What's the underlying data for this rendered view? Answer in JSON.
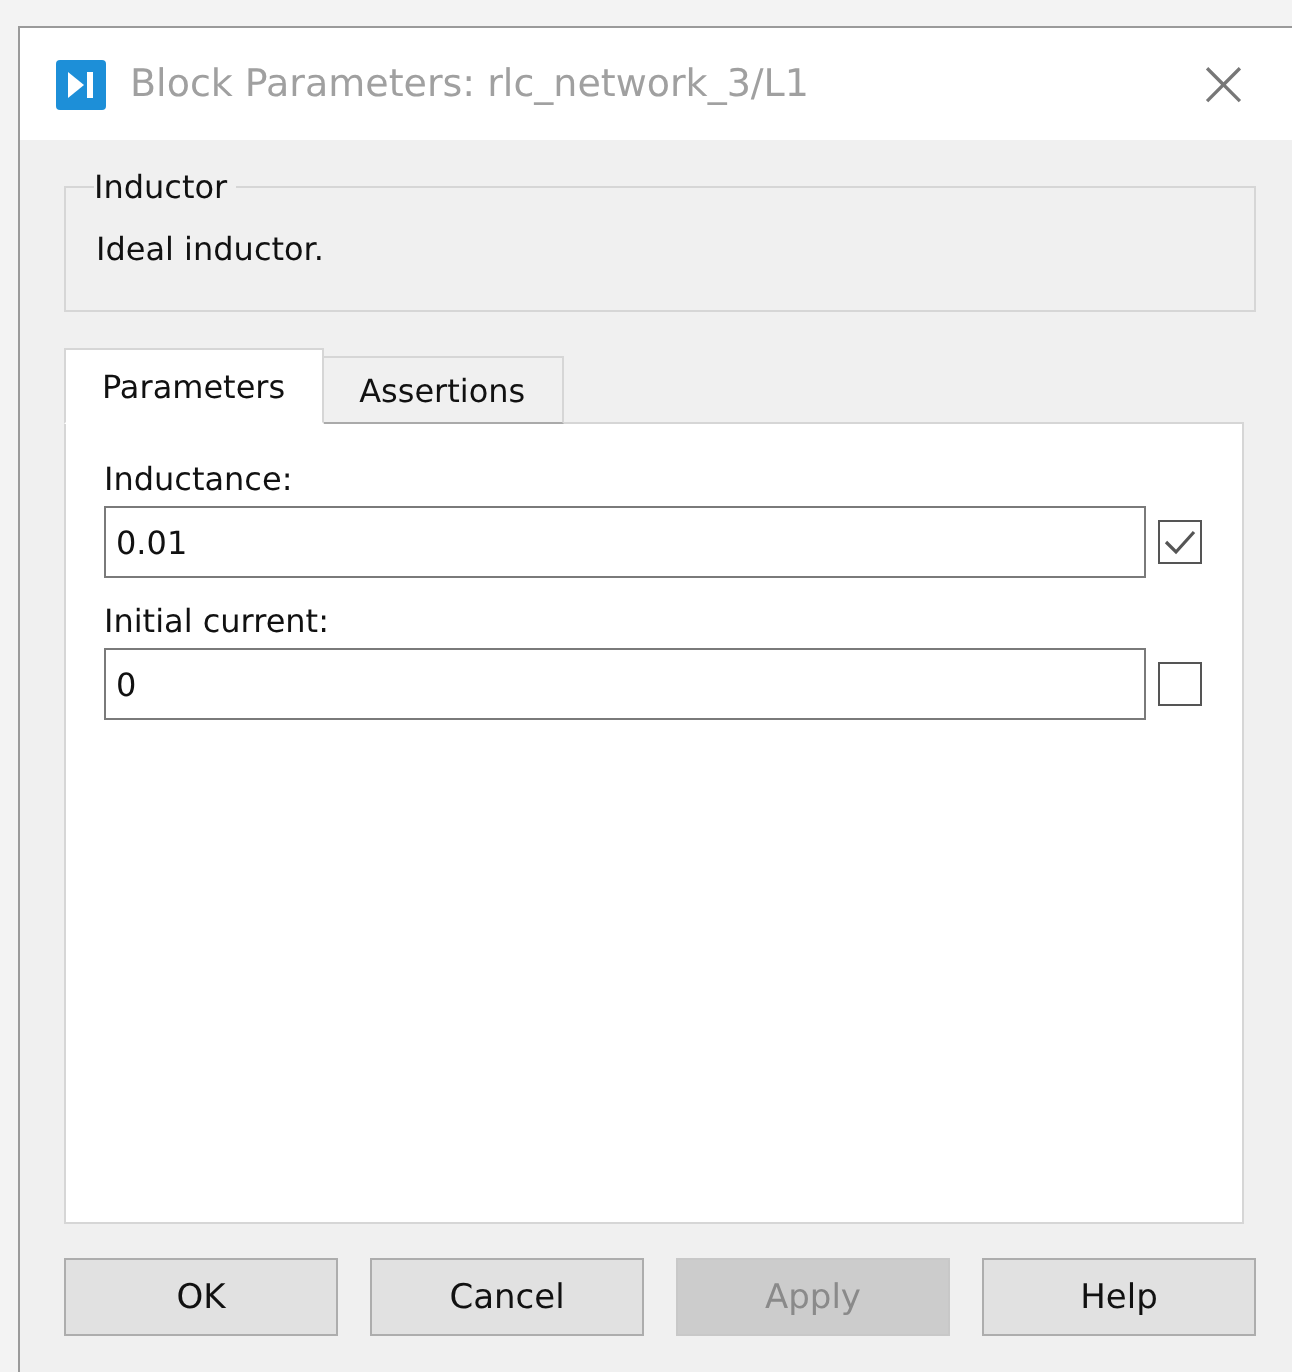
{
  "window": {
    "title": "Block Parameters: rlc_network_3/L1",
    "close": "×"
  },
  "group": {
    "title": "Inductor",
    "description": "Ideal inductor."
  },
  "tabs": [
    {
      "label": "Parameters",
      "selected": true
    },
    {
      "label": "Assertions",
      "selected": false
    }
  ],
  "parameters": [
    {
      "label": "Inductance:",
      "value": "0.01",
      "checked": true
    },
    {
      "label": "Initial current:",
      "value": "0",
      "checked": false
    }
  ],
  "buttons": [
    {
      "label": "OK",
      "disabled": false
    },
    {
      "label": "Cancel",
      "disabled": false
    },
    {
      "label": "Apply",
      "disabled": true
    },
    {
      "label": "Help",
      "disabled": false
    }
  ]
}
